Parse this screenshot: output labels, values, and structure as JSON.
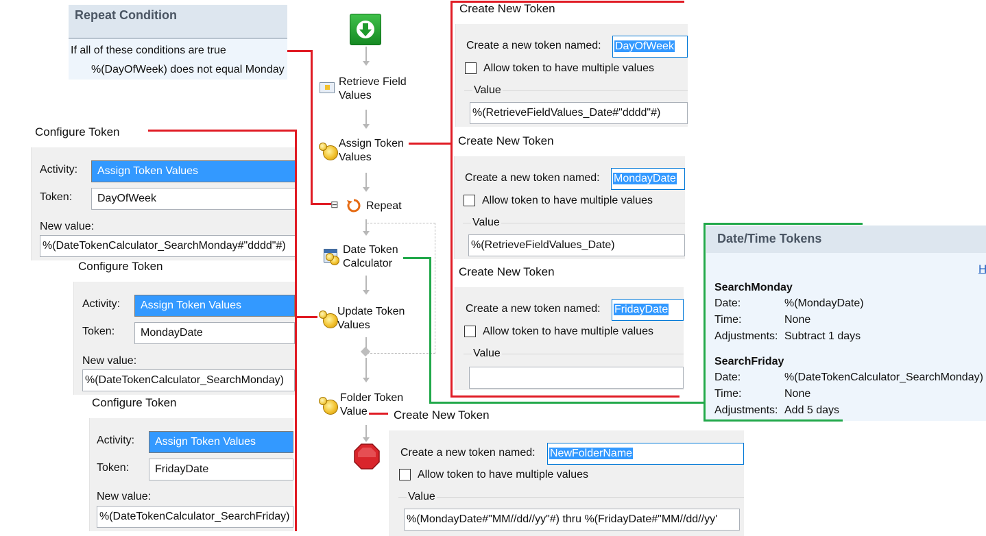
{
  "repeat_condition": {
    "title": "Repeat Condition",
    "intro": "If all of these conditions are true",
    "condition": "%(DayOfWeek) does not equal Monday"
  },
  "workflow": {
    "steps": [
      {
        "label": "Retrieve Field\nValues",
        "icon": "form-field-icon"
      },
      {
        "label": "Assign Token\nValues",
        "icon": "token-icon"
      },
      {
        "label": "Repeat",
        "icon": "repeat-loop-icon"
      },
      {
        "label": "Date Token\nCalculator",
        "icon": "calendar-token-icon"
      },
      {
        "label": "Update Token\nValues",
        "icon": "token-icon"
      },
      {
        "label": "Folder Token\nValue",
        "icon": "token-icon"
      }
    ],
    "collapse_glyph": "⊟"
  },
  "configure_tokens": [
    {
      "caption": "Configure Token",
      "activity_label": "Activity:",
      "activity": "Assign Token Values",
      "token_label": "Token:",
      "token": "DayOfWeek",
      "newvalue_label": "New value:",
      "new_value": "%(DateTokenCalculator_SearchMonday#\"dddd\"#)"
    },
    {
      "caption": "Configure Token",
      "activity_label": "Activity:",
      "activity": "Assign Token Values",
      "token_label": "Token:",
      "token": "MondayDate",
      "newvalue_label": "New value:",
      "new_value": "%(DateTokenCalculator_SearchMonday)"
    },
    {
      "caption": "Configure Token",
      "activity_label": "Activity:",
      "activity": "Assign Token Values",
      "token_label": "Token:",
      "token": "FridayDate",
      "newvalue_label": "New value:",
      "new_value": "%(DateTokenCalculator_SearchFriday)"
    }
  ],
  "create_tokens": [
    {
      "caption": "Create New Token",
      "name_label": "Create a new token named:",
      "name": "DayOfWeek",
      "multi_label": "Allow token to have multiple values",
      "value_label": "Value",
      "value": "%(RetrieveFieldValues_Date#\"dddd\"#)"
    },
    {
      "caption": "Create New Token",
      "name_label": "Create a new token named:",
      "name": "MondayDate",
      "multi_label": "Allow token to have multiple values",
      "value_label": "Value",
      "value": "%(RetrieveFieldValues_Date)"
    },
    {
      "caption": "Create New Token",
      "name_label": "Create a new token named:",
      "name": "FridayDate",
      "multi_label": "Allow token to have multiple values",
      "value_label": "Value",
      "value": ""
    },
    {
      "caption": "Create New Token",
      "name_label": "Create a new token named:",
      "name": "NewFolderName",
      "multi_label": "Allow token to have multiple values",
      "value_label": "Value",
      "value": "%(MondayDate#\"MM//dd//yy\"#) thru %(FridayDate#\"MM//dd//yy'"
    }
  ],
  "date_time_tokens": {
    "title": "Date/Time Tokens",
    "help_link": "H",
    "tokens": [
      {
        "name": "SearchMonday",
        "date_label": "Date:",
        "date": "%(MondayDate)",
        "time_label": "Time:",
        "time": "None",
        "adj_label": "Adjustments:",
        "adjustments": "Subtract 1 days"
      },
      {
        "name": "SearchFriday",
        "date_label": "Date:",
        "date": "%(DateTokenCalculator_SearchMonday)",
        "time_label": "Time:",
        "time": "None",
        "adj_label": "Adjustments:",
        "adjustments": "Add 5 days"
      }
    ]
  },
  "colors": {
    "callout_red": "#e01b24",
    "callout_green": "#21a84a",
    "selection_blue": "#3399ff",
    "start_green": "#1e9a2c",
    "stop_red": "#d9252b"
  }
}
